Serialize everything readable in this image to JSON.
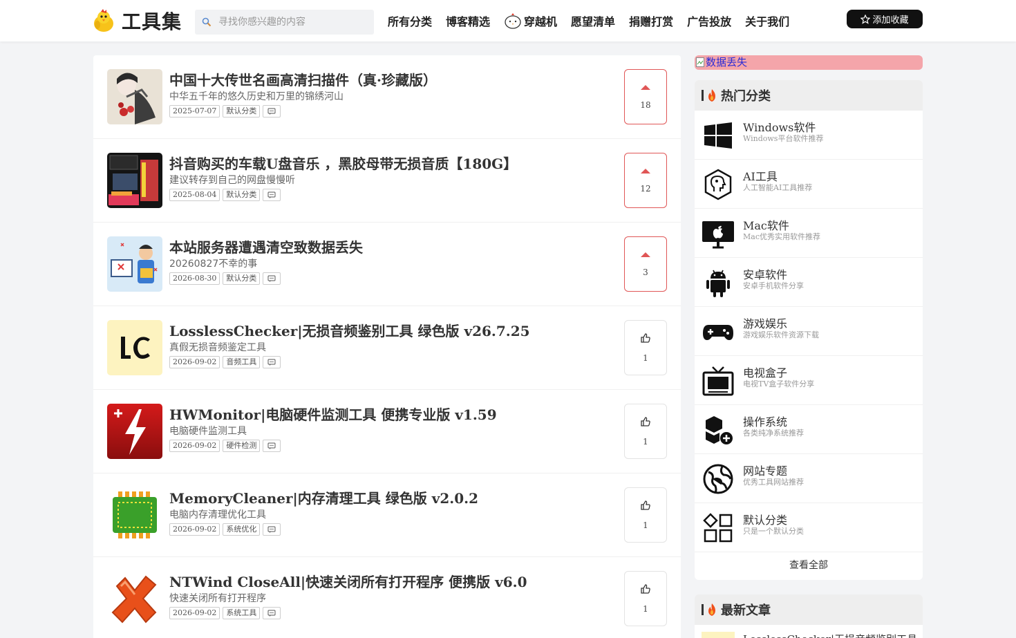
{
  "header": {
    "logo_text": "工具集",
    "search_placeholder": "寻找你感兴趣的内容",
    "nav": [
      "所有分类",
      "博客精选",
      "穿越机",
      "愿望清单",
      "捐赠打赏",
      "广告投放",
      "关于我们"
    ],
    "fav_button": "添加收藏"
  },
  "posts": [
    {
      "title": "中国十大传世名画高清扫描件（真·珍藏版）",
      "subtitle": "中华五千年的悠久历史和万里的锦绣河山",
      "date": "2025-07-07",
      "category": "默认分类",
      "votes": "18",
      "vote_style": "arrow"
    },
    {
      "title": "抖音购买的车载U盘音乐 ，黑胶母带无损音质【180G】",
      "subtitle": "建议转存到自己的网盘慢慢听",
      "date": "2025-08-04",
      "category": "默认分类",
      "votes": "12",
      "vote_style": "arrow"
    },
    {
      "title": "本站服务器遭遇清空致数据丢失",
      "subtitle": "20260827不幸的事",
      "date": "2026-08-30",
      "category": "默认分类",
      "votes": "3",
      "vote_style": "arrow"
    },
    {
      "title": "LosslessChecker|无损音频鉴别工具 绿色版 v26.7.25",
      "subtitle": "真假无损音频鉴定工具",
      "date": "2026-09-02",
      "category": "音频工具",
      "votes": "1",
      "vote_style": "thumb"
    },
    {
      "title": "HWMonitor|电脑硬件监测工具 便携专业版 v1.59",
      "subtitle": "电脑硬件监测工具",
      "date": "2026-09-02",
      "category": "硬件检测",
      "votes": "1",
      "vote_style": "thumb"
    },
    {
      "title": "MemoryCleaner|内存清理工具 绿色版 v2.0.2",
      "subtitle": "电脑内存清理优化工具",
      "date": "2026-09-02",
      "category": "系统优化",
      "votes": "1",
      "vote_style": "thumb"
    },
    {
      "title": "NTWind CloseAll|快速关闭所有打开程序 便携版 v6.0",
      "subtitle": "快速关闭所有打开程序",
      "date": "2026-09-02",
      "category": "系统工具",
      "votes": "1",
      "vote_style": "thumb"
    }
  ],
  "sidebar": {
    "banner_alt": "数据丢失",
    "hot_title": "热门分类",
    "categories": [
      {
        "name": "Windows软件",
        "desc": "Windows平台软件推荐",
        "icon": "windows-icon"
      },
      {
        "name": "AI工具",
        "desc": "人工智能AI工具推荐",
        "icon": "ai-icon"
      },
      {
        "name": "Mac软件",
        "desc": "Mac优秀实用软件推荐",
        "icon": "apple-icon"
      },
      {
        "name": "安卓软件",
        "desc": "安卓手机软件分享",
        "icon": "android-icon"
      },
      {
        "name": "游戏娱乐",
        "desc": "游戏娱乐软件资源下载",
        "icon": "gamepad-icon"
      },
      {
        "name": "电视盒子",
        "desc": "电视TV盒子软件分享",
        "icon": "tv-icon"
      },
      {
        "name": "操作系统",
        "desc": "各类纯净系统推荐",
        "icon": "os-icon"
      },
      {
        "name": "网站专题",
        "desc": "优秀工具网站推荐",
        "icon": "web-icon"
      },
      {
        "name": "默认分类",
        "desc": "只是一个默认分类",
        "icon": "grid-icon"
      }
    ],
    "view_all": "查看全部",
    "latest_title": "最新文章",
    "latest_first": "LosslessChecker|无损音频鉴别工具"
  },
  "colors": {
    "accent_red": "#e05656",
    "banner_bg": "#f4a5aa",
    "fav_bg": "#111111"
  }
}
